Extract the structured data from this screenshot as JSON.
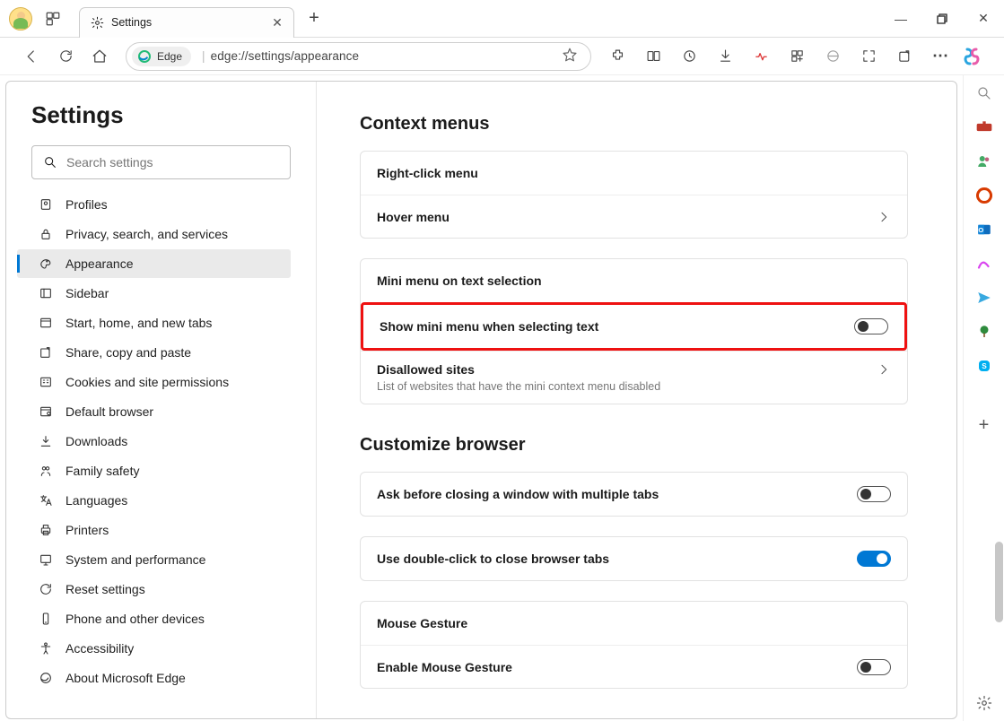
{
  "titlebar": {
    "tab_title": "Settings",
    "workspace_label": "Workspaces",
    "new_tab_label": "+",
    "win_minimize": "—",
    "win_close": "✕"
  },
  "toolbar": {
    "edge_chip_label": "Edge",
    "url_text": "edge://settings/appearance",
    "more": "⋯"
  },
  "sidebar": {
    "heading": "Settings",
    "search_placeholder": "Search settings",
    "items": [
      {
        "label": "Profiles",
        "icon": "profile"
      },
      {
        "label": "Privacy, search, and services",
        "icon": "lock"
      },
      {
        "label": "Appearance",
        "icon": "appearance",
        "active": true
      },
      {
        "label": "Sidebar",
        "icon": "sidebar"
      },
      {
        "label": "Start, home, and new tabs",
        "icon": "start"
      },
      {
        "label": "Share, copy and paste",
        "icon": "share"
      },
      {
        "label": "Cookies and site permissions",
        "icon": "cookies"
      },
      {
        "label": "Default browser",
        "icon": "browser"
      },
      {
        "label": "Downloads",
        "icon": "download"
      },
      {
        "label": "Family safety",
        "icon": "family"
      },
      {
        "label": "Languages",
        "icon": "lang"
      },
      {
        "label": "Printers",
        "icon": "printer"
      },
      {
        "label": "System and performance",
        "icon": "system"
      },
      {
        "label": "Reset settings",
        "icon": "reset"
      },
      {
        "label": "Phone and other devices",
        "icon": "phone"
      },
      {
        "label": "Accessibility",
        "icon": "a11y"
      },
      {
        "label": "About Microsoft Edge",
        "icon": "edge"
      }
    ]
  },
  "main": {
    "section1_title": "Context menus",
    "right_click": "Right-click menu",
    "hover_menu": "Hover menu",
    "mini_menu_header": "Mini menu on text selection",
    "show_mini": "Show mini menu when selecting text",
    "disallowed": "Disallowed sites",
    "disallowed_desc": "List of websites that have the mini context menu disabled",
    "section2_title": "Customize browser",
    "ask_close": "Ask before closing a window with multiple tabs",
    "dbl_click": "Use double-click to close browser tabs",
    "mouse_gesture": "Mouse Gesture",
    "enable_gesture": "Enable Mouse Gesture"
  },
  "toggles": {
    "show_mini": false,
    "ask_close": false,
    "dbl_click": true,
    "enable_gesture": false
  },
  "colors": {
    "accent": "#0078d4",
    "highlight": "#e11"
  }
}
